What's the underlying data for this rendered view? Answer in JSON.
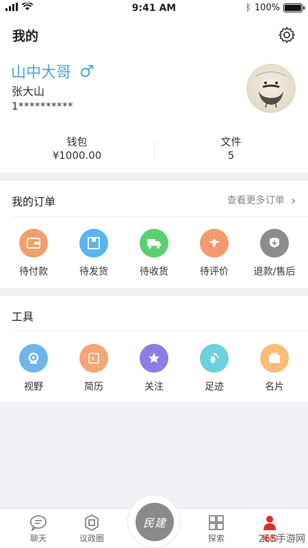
{
  "status_bar": {
    "time": "9:41 AM",
    "battery": "100%",
    "battery_level": 1.0
  },
  "header": {
    "title": "我的",
    "settings_icon": "gear-icon"
  },
  "profile": {
    "nickname": "山中大哥",
    "gender_symbol": "♂",
    "real_name": "张大山",
    "phone": "1**********"
  },
  "stats": [
    {
      "label": "钱包",
      "value": "¥1000.00"
    },
    {
      "label": "文件",
      "value": "5"
    }
  ],
  "orders": {
    "title": "我的订单",
    "more_label": "查看更多订单",
    "items": [
      {
        "label": "待付款",
        "icon": "wallet-icon",
        "color": "#f2a06b"
      },
      {
        "label": "待发货",
        "icon": "box-icon",
        "color": "#59b5f0"
      },
      {
        "label": "待收货",
        "icon": "truck-icon",
        "color": "#5ccf72"
      },
      {
        "label": "待评价",
        "icon": "review-icon",
        "color": "#f49a6d"
      },
      {
        "label": "退款/售后",
        "icon": "refund-icon",
        "color": "#8c8c8c"
      }
    ]
  },
  "tools": {
    "title": "工具",
    "items": [
      {
        "label": "视野",
        "icon": "camera-icon",
        "color": "#6fb5ea"
      },
      {
        "label": "简历",
        "icon": "resume-icon",
        "color": "#f5a676"
      },
      {
        "label": "关注",
        "icon": "star-icon",
        "color": "#8f7be6"
      },
      {
        "label": "足迹",
        "icon": "footprint-icon",
        "color": "#6dd0de"
      },
      {
        "label": "名片",
        "icon": "card-icon",
        "color": "#f8be78"
      }
    ]
  },
  "tabbar": {
    "items": [
      {
        "label": "聊天",
        "icon": "chat-icon"
      },
      {
        "label": "议政圈",
        "icon": "circle-icon"
      },
      {
        "label": "探索",
        "icon": "explore-icon"
      },
      {
        "label": "我的",
        "icon": "profile-icon",
        "active_color": "#e02e24"
      }
    ],
    "center_label": "民建"
  },
  "watermark": "265手游网"
}
